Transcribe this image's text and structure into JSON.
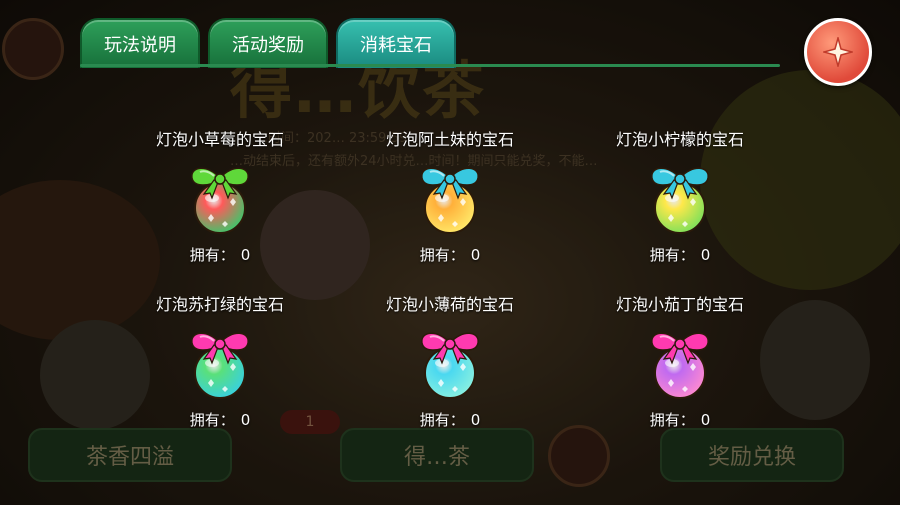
{
  "background": {
    "title": "得…饮茶",
    "time_line": "…时间：202… 23:59:59",
    "notice_line": "…动结束后，还有额外24小时兑…时间！期间只能兑奖，不能…",
    "counter": "1",
    "buttons": [
      "茶香四溢",
      "得…茶",
      "奖励兑换"
    ]
  },
  "tabs": [
    {
      "label": "玩法说明",
      "active": false
    },
    {
      "label": "活动奖励",
      "active": false
    },
    {
      "label": "消耗宝石",
      "active": true
    }
  ],
  "close_icon": "close-star-icon",
  "gems": [
    {
      "name": "灯泡小草莓的宝石",
      "owned_label": "拥有：",
      "count": "0",
      "bow_color": "#5fd83a",
      "gem_colors": [
        "#ff5a5a",
        "#3ac86a"
      ]
    },
    {
      "name": "灯泡阿土妹的宝石",
      "owned_label": "拥有：",
      "count": "0",
      "bow_color": "#38c8e0",
      "gem_colors": [
        "#ffb03a",
        "#ffea6a"
      ]
    },
    {
      "name": "灯泡小柠檬的宝石",
      "owned_label": "拥有：",
      "count": "0",
      "bow_color": "#38c8e0",
      "gem_colors": [
        "#ffe84a",
        "#7ae05a"
      ]
    },
    {
      "name": "灯泡苏打绿的宝石",
      "owned_label": "拥有：",
      "count": "0",
      "bow_color": "#ff3ab0",
      "gem_colors": [
        "#5ae07a",
        "#38d0e0"
      ]
    },
    {
      "name": "灯泡小薄荷的宝石",
      "owned_label": "拥有：",
      "count": "0",
      "bow_color": "#ff3ab0",
      "gem_colors": [
        "#4ad8f0",
        "#8af0e0"
      ]
    },
    {
      "name": "灯泡小茄丁的宝石",
      "owned_label": "拥有：",
      "count": "0",
      "bow_color": "#ff3ab0",
      "gem_colors": [
        "#c06af0",
        "#ff8ad0"
      ]
    }
  ]
}
